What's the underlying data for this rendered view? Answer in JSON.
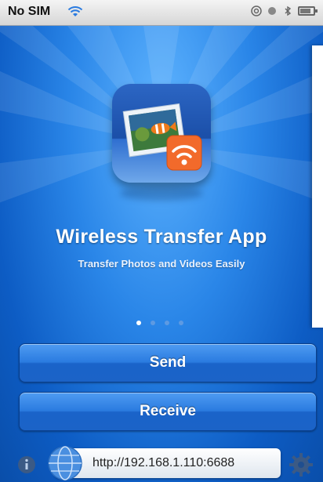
{
  "status_bar": {
    "carrier": "No SIM",
    "wifi_icon": "wifi-icon",
    "icons": [
      "at-icon",
      "alarm-icon",
      "bluetooth-icon",
      "battery-icon"
    ]
  },
  "hero": {
    "title": "Wireless Transfer App",
    "subtitle": "Transfer Photos and Videos Easily",
    "page_indicator": {
      "total": 4,
      "current": 1
    }
  },
  "actions": {
    "send_label": "Send",
    "receive_label": "Receive"
  },
  "footer": {
    "url": "http://192.168.1.110:6688",
    "info_icon": "info-icon",
    "settings_icon": "gear-icon"
  },
  "colors": {
    "background": "#0f5fc6",
    "button": "#2a7be0",
    "active_dot": "#ffffff"
  }
}
